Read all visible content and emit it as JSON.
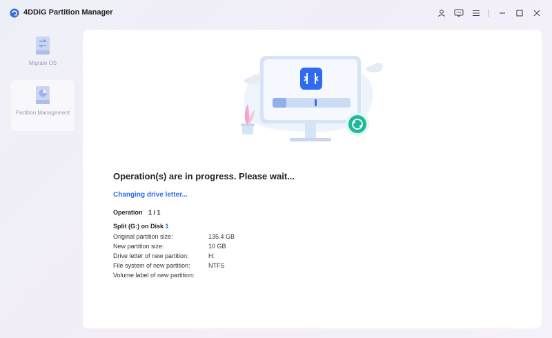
{
  "app": {
    "title": "4DDiG Partition Manager"
  },
  "titlebar": {
    "icons": [
      "user-icon",
      "feedback-icon",
      "menu-icon",
      "minimize-icon",
      "maximize-icon",
      "close-icon"
    ]
  },
  "sidebar": {
    "items": [
      {
        "label": "Migrate OS",
        "icon": "migrate-os-icon"
      },
      {
        "label": "Partition Management",
        "icon": "partition-management-icon",
        "active": true
      }
    ]
  },
  "main": {
    "status_title": "Operation(s) are in progress. Please wait...",
    "current_step": "Changing drive letter...",
    "operation_label": "Operation",
    "operation_count": "1 / 1",
    "split_prefix": "Split (G:) on Disk ",
    "split_disk": "1",
    "details": [
      {
        "label": "Original partition size:",
        "value": "135.4 GB"
      },
      {
        "label": "New partition size:",
        "value": "10 GB"
      },
      {
        "label": "Drive letter of new partition:",
        "value": "H:"
      },
      {
        "label": "File system of new partition:",
        "value": "NTFS"
      },
      {
        "label": "Volume label of new partition:",
        "value": ""
      }
    ]
  },
  "colors": {
    "accent": "#2d6cf0",
    "teal": "#1fb89a",
    "panel": "#ffffff"
  }
}
